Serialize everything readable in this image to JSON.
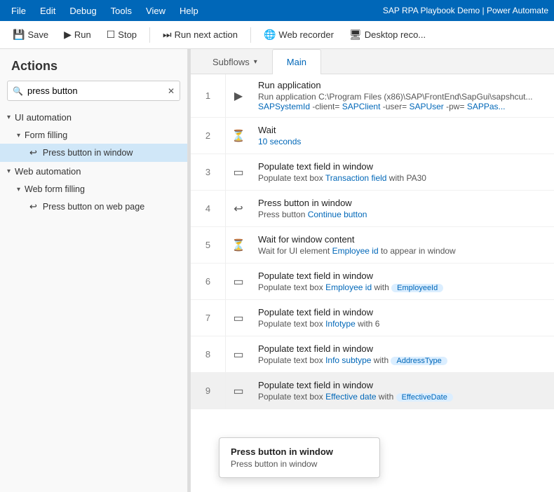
{
  "menubar": {
    "items": [
      "File",
      "Edit",
      "Debug",
      "Tools",
      "View",
      "Help"
    ],
    "appTitle": "SAP RPA Playbook Demo | Power Automate"
  },
  "toolbar": {
    "save_label": "Save",
    "run_label": "Run",
    "stop_label": "Stop",
    "run_next_label": "Run next action",
    "web_recorder_label": "Web recorder",
    "desktop_recorder_label": "Desktop reco..."
  },
  "sidebar": {
    "header": "Actions",
    "search": {
      "placeholder": "press button",
      "value": "press button"
    },
    "categories": [
      {
        "name": "UI automation",
        "expanded": true,
        "subcategories": [
          {
            "name": "Form filling",
            "expanded": true,
            "items": [
              {
                "label": "Press button in window",
                "selected": true
              }
            ]
          }
        ]
      },
      {
        "name": "Web automation",
        "expanded": true,
        "subcategories": [
          {
            "name": "Web form filling",
            "expanded": true,
            "items": [
              {
                "label": "Press button on web page",
                "selected": false
              }
            ]
          }
        ]
      }
    ]
  },
  "tabs": [
    {
      "label": "Subflows",
      "hasChevron": true,
      "active": false
    },
    {
      "label": "Main",
      "hasChevron": false,
      "active": true
    }
  ],
  "steps": [
    {
      "number": "1",
      "icon": "▶",
      "title": "Run application",
      "desc": "Run application C:\\Program Files (x86)\\SAP\\FrontEnd\\SapGui\\sapshcut... SAPSystemId  -client=  SAPClient  -user=  SAPUser  -pw=  SAPPas..."
    },
    {
      "number": "2",
      "icon": "⏳",
      "title": "Wait",
      "desc": "10 seconds",
      "linkPart": "10 seconds"
    },
    {
      "number": "3",
      "icon": "▭",
      "title": "Populate text field in window",
      "desc": "Populate text box Transaction field with PA30",
      "links": [
        "Transaction field"
      ],
      "plain": [
        "Populate text box ",
        " with PA30"
      ]
    },
    {
      "number": "4",
      "icon": "↩",
      "title": "Press button in window",
      "desc": "Press button Continue button",
      "links": [
        "Continue button"
      ],
      "plain": [
        "Press button "
      ]
    },
    {
      "number": "5",
      "icon": "⏳",
      "title": "Wait for window content",
      "desc": "Wait for UI element Employee id to appear in window",
      "links": [
        "Employee id"
      ],
      "plain": [
        "Wait for UI element ",
        " to appear in window"
      ]
    },
    {
      "number": "6",
      "icon": "▭",
      "title": "Populate text field in window",
      "desc": "Populate text box Employee id with",
      "links": [
        "Employee id"
      ],
      "chip": "EmployeeId",
      "plain": [
        "Populate text box ",
        " with "
      ]
    },
    {
      "number": "7",
      "icon": "▭",
      "title": "Populate text field in window",
      "desc": "Populate text box Infotype with 6",
      "links": [
        "Infotype"
      ],
      "plain": [
        "Populate text box ",
        " with 6"
      ]
    },
    {
      "number": "8",
      "icon": "▭",
      "title": "Populate text field in window",
      "desc": "Populate text box Info subtype with",
      "links": [
        "Info subtype"
      ],
      "chip": "AddressType",
      "plain": [
        "Populate text box ",
        " with "
      ]
    },
    {
      "number": "9",
      "icon": "▭",
      "title": "Populate text field in window",
      "desc": "Populate text box Effective date with",
      "links": [
        "Effective date"
      ],
      "chip": "EffectiveDate",
      "plain": [
        "Populate text box ",
        " with "
      ],
      "highlighted": true
    }
  ],
  "tooltip": {
    "title": "Press button in window",
    "desc": "Press button in window"
  },
  "icons": {
    "search": "🔍",
    "clear": "✕",
    "chevron_down": "▾",
    "chevron_right": "›",
    "save": "💾",
    "run": "▶",
    "stop": "⏹",
    "run_next": "⏭",
    "web_recorder": "🌐",
    "desktop_recorder": "🖥"
  }
}
